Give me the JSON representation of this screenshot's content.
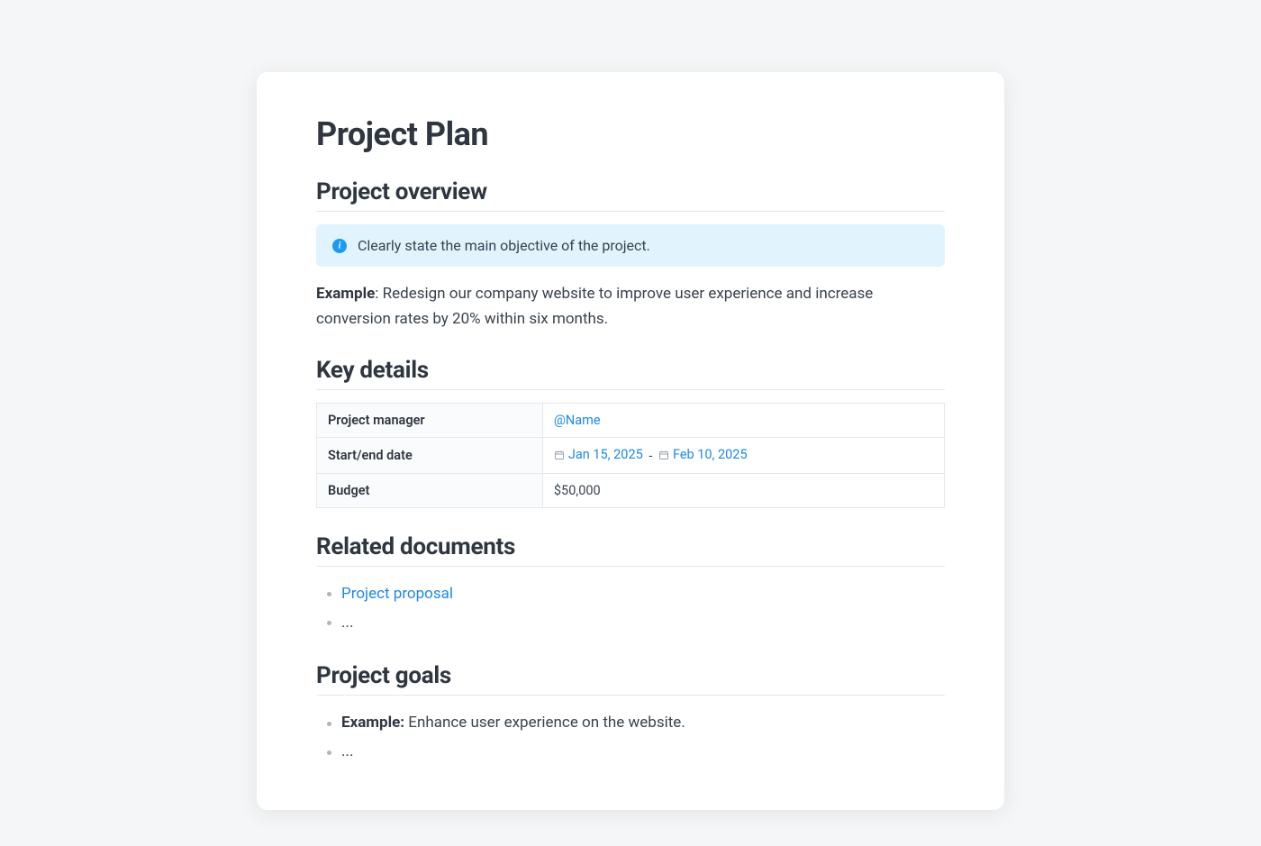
{
  "title": "Project Plan",
  "overview": {
    "heading": "Project overview",
    "callout": "Clearly state the main objective of the project.",
    "example_label": "Example",
    "example_text": ": Redesign our company website to improve user experience and increase conversion rates by 20% within six months."
  },
  "key_details": {
    "heading": "Key details",
    "rows": {
      "manager_label": "Project manager",
      "manager_value": "@Name",
      "dates_label": "Start/end date",
      "start_date": "Jan 15, 2025",
      "end_date": "Feb 10, 2025",
      "date_separator": " - ",
      "budget_label": "Budget",
      "budget_value": "$50,000"
    }
  },
  "related": {
    "heading": "Related documents",
    "item1": "Project proposal",
    "placeholder": "..."
  },
  "goals": {
    "heading": "Project goals",
    "example_label": "Example:",
    "example_text": " Enhance user experience on the website.",
    "placeholder": "..."
  }
}
